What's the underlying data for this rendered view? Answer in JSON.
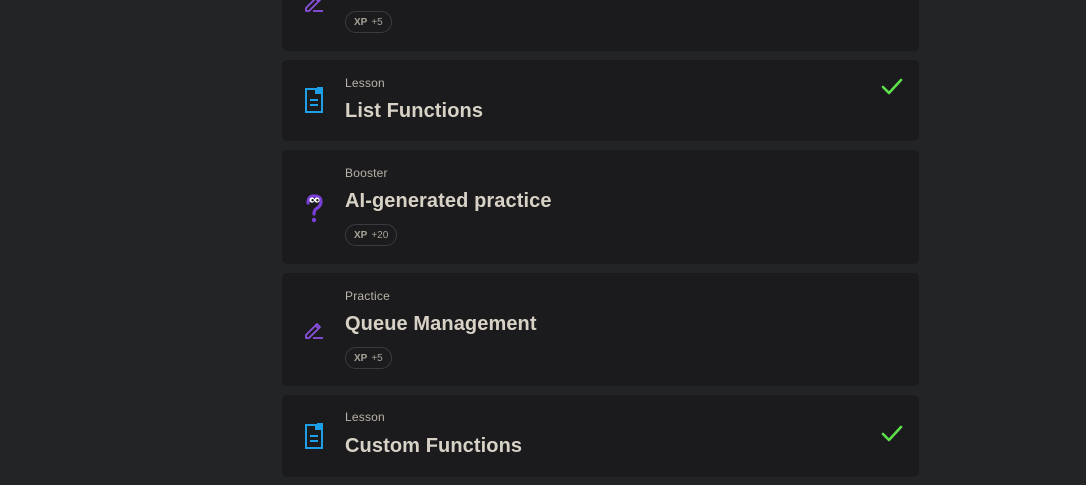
{
  "colors": {
    "background": "#232426",
    "card": "#1b1b1d",
    "lesson_icon": "#1ea0e8",
    "practice_icon": "#8b50e0",
    "booster_icon": "#7a3fd6",
    "check": "#5de04a"
  },
  "items": [
    {
      "kind": "",
      "title": "",
      "icon": "pencil-icon",
      "xp_label": "XP",
      "xp_value": "+5",
      "completed": false
    },
    {
      "kind": "Lesson",
      "title": "List Functions",
      "icon": "document-icon",
      "completed": true
    },
    {
      "kind": "Booster",
      "title": "AI-generated practice",
      "icon": "question-mark-icon",
      "xp_label": "XP",
      "xp_value": "+20",
      "completed": false
    },
    {
      "kind": "Practice",
      "title": "Queue Management",
      "icon": "pencil-icon",
      "xp_label": "XP",
      "xp_value": "+5",
      "completed": false
    },
    {
      "kind": "Lesson",
      "title": "Custom Functions",
      "icon": "document-icon",
      "completed": true
    }
  ]
}
